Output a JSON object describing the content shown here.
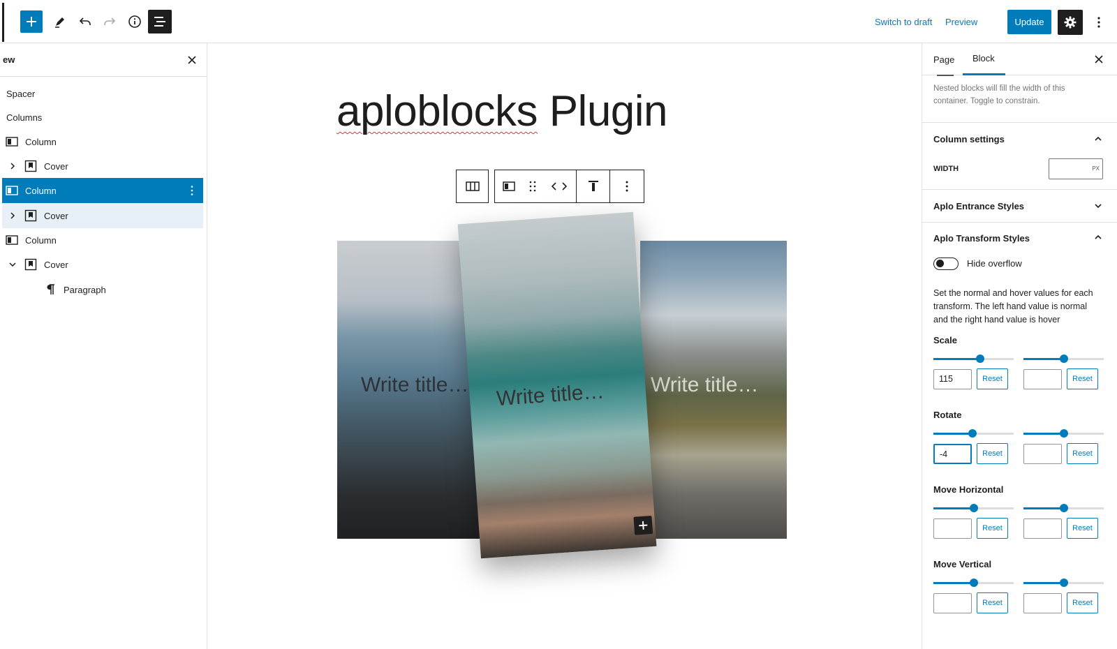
{
  "toolbar": {
    "switch_to_draft": "Switch to draft",
    "preview": "Preview",
    "update": "Update"
  },
  "list_view": {
    "title": "ew",
    "items": [
      {
        "label": "Spacer"
      },
      {
        "label": "Columns"
      },
      {
        "label": "Column"
      },
      {
        "label": "Cover"
      },
      {
        "label": "Column"
      },
      {
        "label": "Cover"
      },
      {
        "label": "Column"
      },
      {
        "label": "Cover"
      },
      {
        "label": "Paragraph"
      }
    ]
  },
  "canvas": {
    "title_part1": "aploblocks",
    "title_part2": " Plugin",
    "cover_titles": [
      "Write title…",
      "Write title…",
      "Write title…"
    ]
  },
  "sidebar": {
    "tabs": [
      "Page",
      "Block"
    ],
    "help_text": "Nested blocks will fill the width of this container. Toggle to constrain.",
    "column_settings": "Column settings",
    "width_label": "WIDTH",
    "width_unit": "PX",
    "entrance_styles": "Aplo Entrance Styles",
    "transform_styles": "Aplo Transform Styles",
    "hide_overflow": "Hide overflow",
    "description": "Set the normal and hover values for each transform. The left hand value is normal and the right hand value is hover",
    "reset_label": "Reset",
    "controls": [
      {
        "title": "Scale",
        "normal_value": "115",
        "hover_value": "",
        "normal_slider": 0.58,
        "hover_slider": 0.5
      },
      {
        "title": "Rotate",
        "normal_value": "-4",
        "hover_value": "",
        "normal_slider": 0.49,
        "hover_slider": 0.5
      },
      {
        "title": "Move Horizontal",
        "normal_value": "",
        "hover_value": "",
        "normal_slider": 0.5,
        "hover_slider": 0.5
      },
      {
        "title": "Move Vertical",
        "normal_value": "",
        "hover_value": "",
        "normal_slider": 0.5,
        "hover_slider": 0.5
      }
    ]
  },
  "colors": {
    "accent": "#007cba",
    "dark": "#1e1e1e"
  }
}
